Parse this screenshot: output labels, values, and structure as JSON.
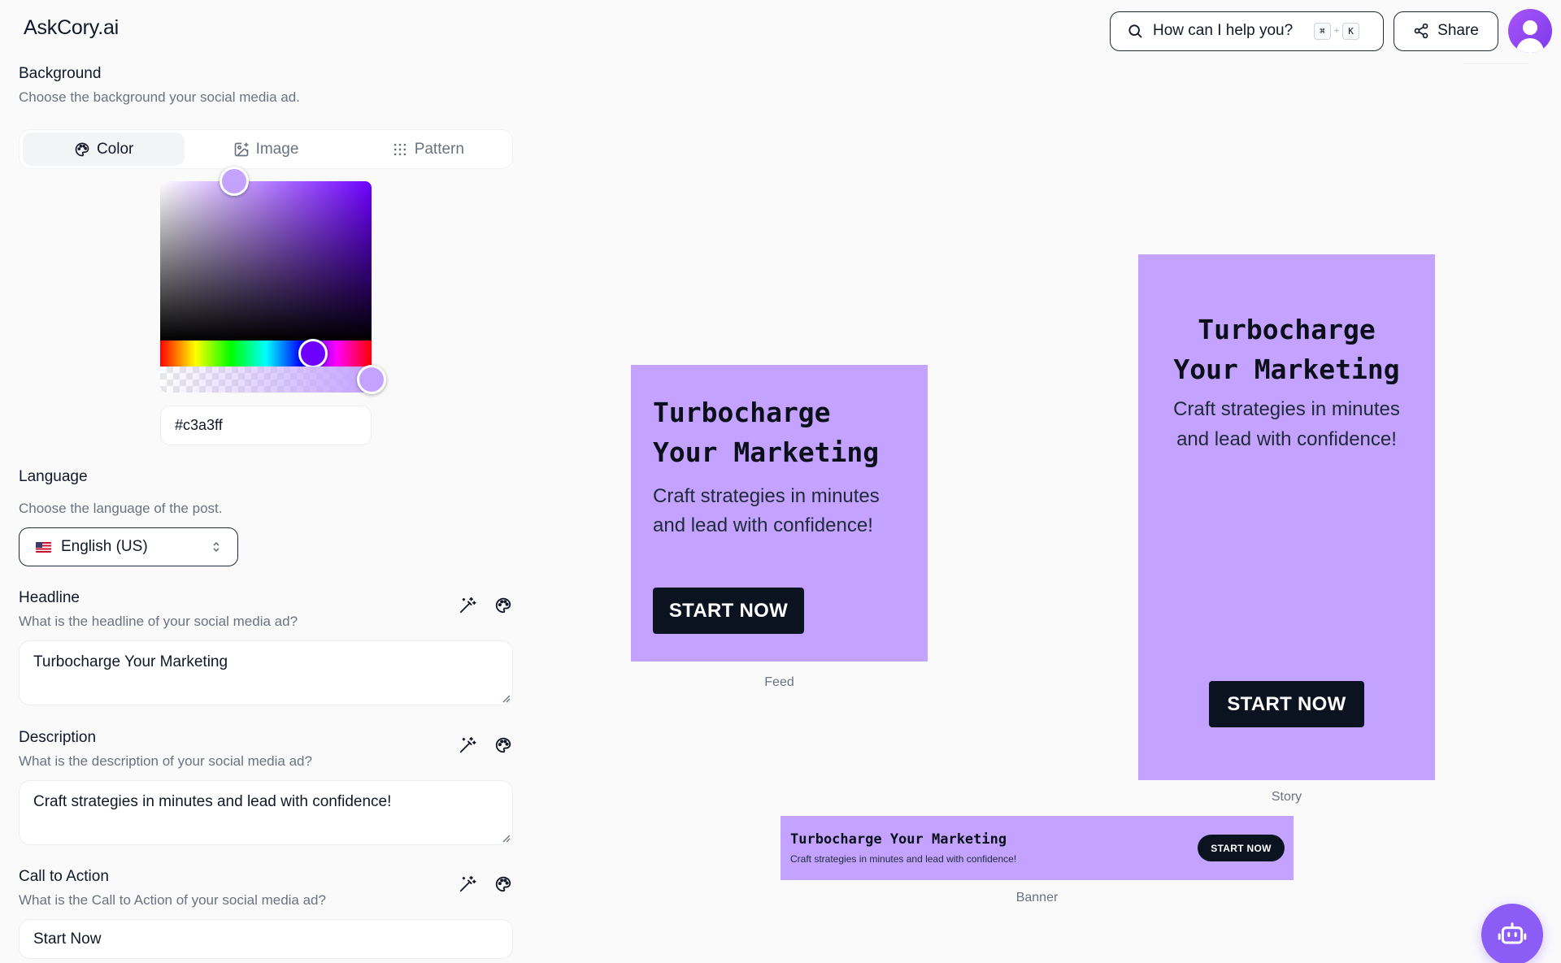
{
  "app": {
    "brand": "AskCory.ai"
  },
  "topbar": {
    "search_label": "How can I help you?",
    "shortcut_keys": [
      "⌘",
      "K"
    ],
    "shortcut_plus": "+",
    "share_label": "Share"
  },
  "background": {
    "title": "Background",
    "desc": "Choose the background your social media ad.",
    "tabs": [
      {
        "label": "Color",
        "icon": "palette-icon",
        "active": true
      },
      {
        "label": "Image",
        "icon": "image-plus-icon",
        "active": false
      },
      {
        "label": "Pattern",
        "icon": "grid-dots-icon",
        "active": false
      }
    ],
    "hex_value": "#c3a3ff",
    "selected_color": "#c3a3ff",
    "hue_color": "#6d00ff"
  },
  "language": {
    "title": "Language",
    "desc": "Choose the language of the post.",
    "selected": "English (US)"
  },
  "headline": {
    "title": "Headline",
    "desc": "What is the headline of your social media ad?",
    "value": "Turbocharge Your Marketing"
  },
  "description": {
    "title": "Description",
    "desc": "What is the description of your social media ad?",
    "value": "Craft strategies in minutes and lead with confidence!"
  },
  "cta": {
    "title": "Call to Action",
    "desc": "What is the Call to Action of your social media ad?",
    "value": "Start Now"
  },
  "previews": {
    "headline_line1": "Turbocharge",
    "headline_line2": "Your Marketing",
    "headline_full": "Turbocharge Your Marketing",
    "desc_line1": "Craft strategies in minutes",
    "desc_line2": "and lead with confidence!",
    "desc_full": "Craft strategies in minutes and lead with confidence!",
    "cta_label": "START NOW",
    "feed_label": "Feed",
    "story_label": "Story",
    "banner_label": "Banner",
    "ad_background": "#c3a3ff",
    "cta_background": "#0b1220"
  }
}
